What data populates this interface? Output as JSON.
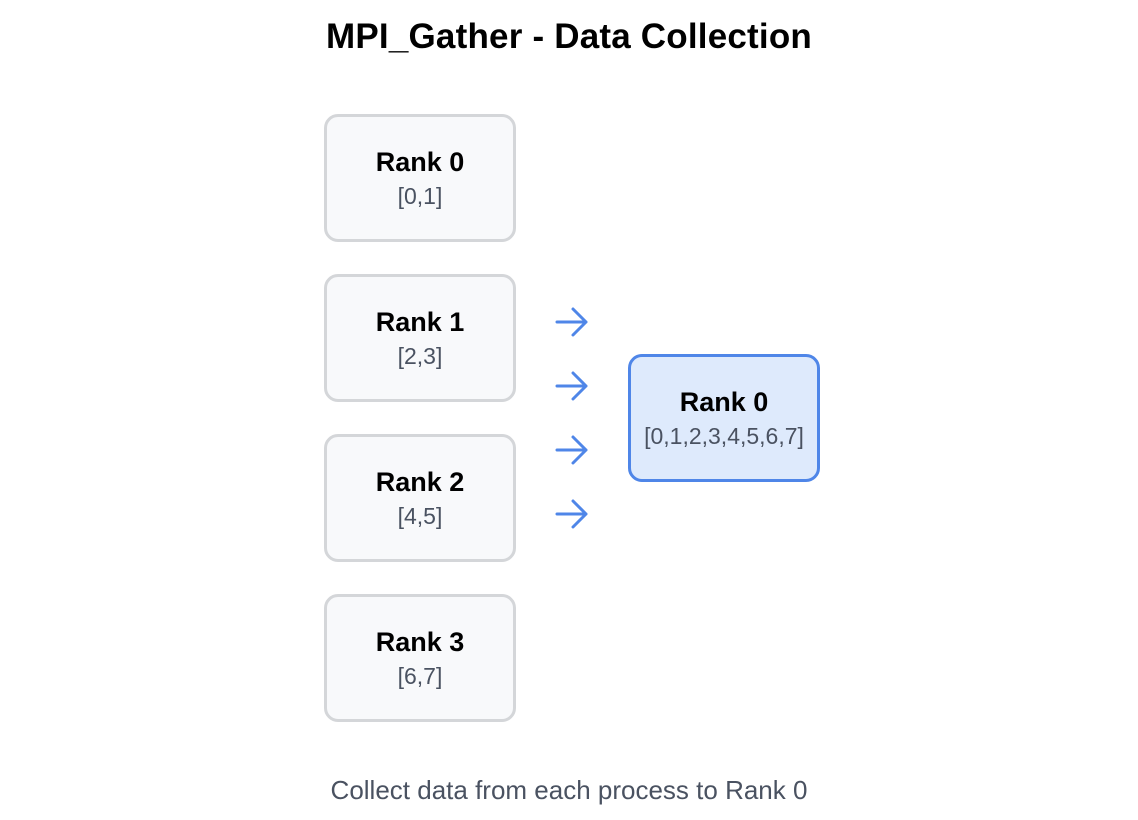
{
  "title": "MPI_Gather - Data Collection",
  "sources": [
    {
      "name": "Rank 0",
      "values": "[0,1]"
    },
    {
      "name": "Rank 1",
      "values": "[2,3]"
    },
    {
      "name": "Rank 2",
      "values": "[4,5]"
    },
    {
      "name": "Rank 3",
      "values": "[6,7]"
    }
  ],
  "arrow_count": 4,
  "destination": {
    "name": "Rank 0",
    "values": "[0,1,2,3,4,5,6,7]"
  },
  "caption": "Collect data from each process to Rank 0",
  "colors": {
    "arrow": "#4f86e8",
    "source_border": "#d4d6d9",
    "source_fill": "#f8f9fb",
    "dest_border": "#4f86e8",
    "dest_fill": "#deeafc",
    "muted_text": "#4a5261"
  },
  "icons": {
    "arrow": "arrow-right-icon"
  }
}
